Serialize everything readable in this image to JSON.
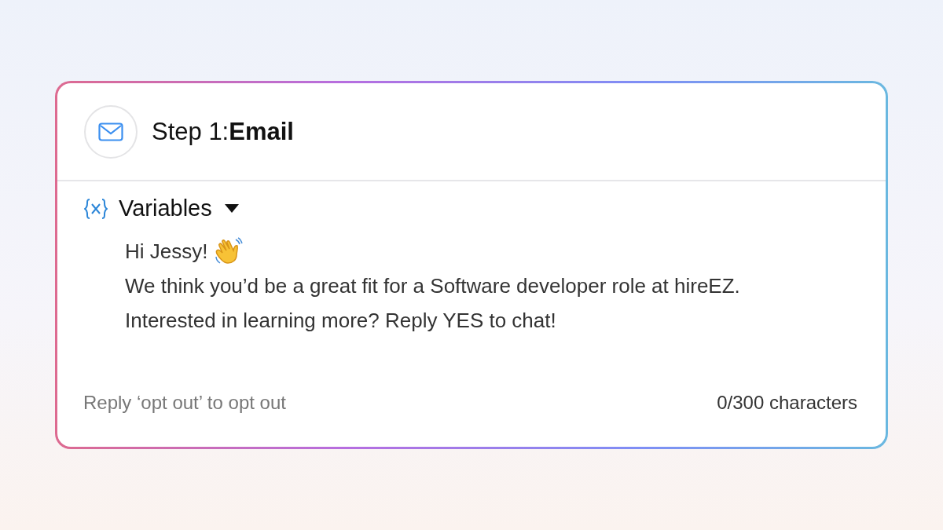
{
  "step": {
    "title": "Step 1:**Email**"
  },
  "variables": {
    "label": "Variables",
    "expanded": false
  },
  "message": {
    "lines": [
      "Hi Jessy!",
      "We think you’d be a great fit for a Software developer role at hireEZ.",
      "Interested in learning more? Reply YES to chat!"
    ]
  },
  "footer": {
    "hint": "Reply ‘opt out’ to opt out",
    "counter": "0/300 characters"
  }
}
